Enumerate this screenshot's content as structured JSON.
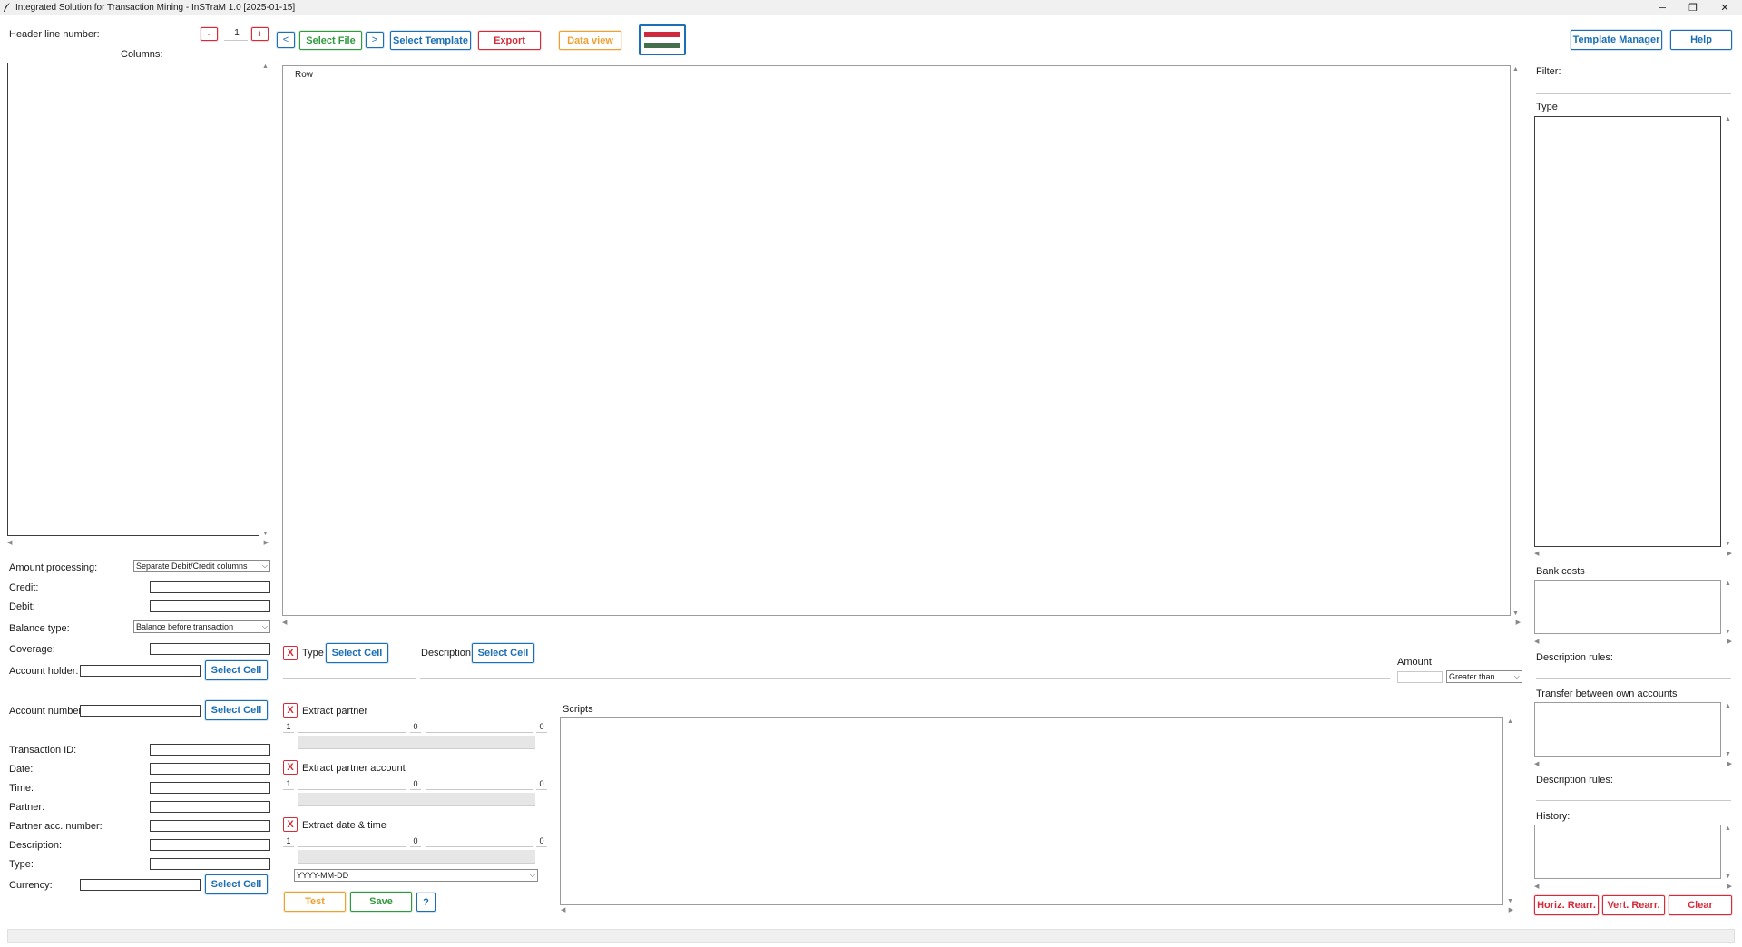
{
  "window": {
    "title": "Integrated Solution for Transaction Mining - InSTraM 1.0 [2025-01-15]",
    "minimize_glyph": "─",
    "maximize_glyph": "❐",
    "close_glyph": "✕"
  },
  "toolbar": {
    "header_line_label": "Header line number:",
    "header_line_value": "1",
    "minus_label": "-",
    "plus_label": "+",
    "prev_label": "<",
    "next_label": ">",
    "select_file": "Select File",
    "select_template": "Select Template",
    "export": "Export",
    "data_view": "Data view",
    "template_manager": "Template Manager",
    "help": "Help"
  },
  "left": {
    "columns_label": "Columns:",
    "amount_processing_label": "Amount processing:",
    "amount_processing_value": "Separate Debit/Credit columns",
    "credit_label": "Credit:",
    "debit_label": "Debit:",
    "balance_type_label": "Balance type:",
    "balance_type_value": "Balance before transaction",
    "coverage_label": "Coverage:",
    "account_holder_label": "Account holder:",
    "account_number_label": "Account number:",
    "transaction_id_label": "Transaction ID:",
    "date_label": "Date:",
    "time_label": "Time:",
    "partner_label": "Partner:",
    "partner_acc_label": "Partner acc. number:",
    "description_label": "Description:",
    "type_label": "Type:",
    "currency_label": "Currency:",
    "select_cell": "Select Cell"
  },
  "center": {
    "row_header": "Row",
    "x_label": "X",
    "type_label": "Type",
    "description_label": "Description",
    "select_cell": "Select Cell",
    "amount_label": "Amount",
    "amount_compare_value": "Greater than",
    "extract_partner": "Extract partner",
    "extract_partner_account": "Extract partner account",
    "extract_datetime": "Extract date & time",
    "spin_start": "1",
    "spin_mid": "0",
    "spin_end": "0",
    "date_format_value": "YYYY-MM-DD",
    "scripts_label": "Scripts",
    "test": "Test",
    "save": "Save",
    "question": "?"
  },
  "right": {
    "filter_label": "Filter:",
    "type_label": "Type",
    "bank_costs_label": "Bank costs",
    "description_rules_label": "Description rules:",
    "transfer_label": "Transfer between own accounts",
    "history_label": "History:",
    "horiz_rearr": "Horiz. Rearr.",
    "vert_rearr": "Vert. Rearr.",
    "clear": "Clear"
  },
  "colors": {
    "blue": "#1b6fb4",
    "green": "#2f9a3d",
    "red": "#d42b3a",
    "orange": "#f0a030",
    "flag_red": "#cd2a3e",
    "flag_white": "#ffffff",
    "flag_green": "#436f4d"
  }
}
